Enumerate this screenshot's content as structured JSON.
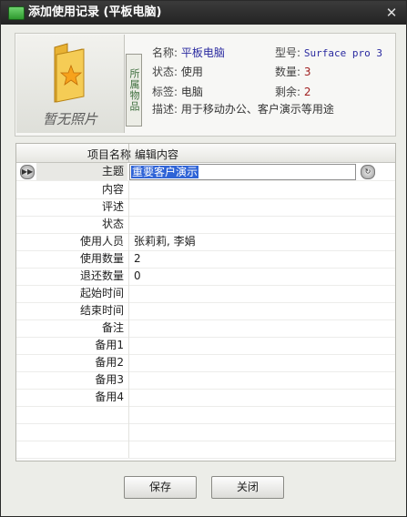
{
  "window": {
    "title": "添加使用记录 (平板电脑)",
    "close_glyph": "✕"
  },
  "item": {
    "photo_caption": "暂无照片",
    "category_tag": "所属物品",
    "name_label": "名称:",
    "name": "平板电脑",
    "model_label": "型号:",
    "model": "Surface pro 3",
    "status_label": "状态:",
    "status": "使用",
    "quantity_label": "数量:",
    "quantity": "3",
    "tag_label": "标签:",
    "tag": "电脑",
    "remaining_label": "剩余:",
    "remaining": "2",
    "desc_label": "描述:",
    "desc": "用于移动办公、客户演示等用途"
  },
  "grid": {
    "col_name": "项目名称",
    "col_value": "编辑内容",
    "rows": [
      {
        "name": "主题",
        "value": "重要客户演示"
      },
      {
        "name": "内容",
        "value": ""
      },
      {
        "name": "评述",
        "value": ""
      },
      {
        "name": "状态",
        "value": ""
      },
      {
        "name": "使用人员",
        "value": "张莉莉, 李娟"
      },
      {
        "name": "使用数量",
        "value": "2"
      },
      {
        "name": "退还数量",
        "value": "0"
      },
      {
        "name": "起始时间",
        "value": ""
      },
      {
        "name": "结束时间",
        "value": ""
      },
      {
        "name": "备注",
        "value": ""
      },
      {
        "name": "备用1",
        "value": ""
      },
      {
        "name": "备用2",
        "value": ""
      },
      {
        "name": "备用3",
        "value": ""
      },
      {
        "name": "备用4",
        "value": ""
      }
    ]
  },
  "buttons": {
    "save": "保存",
    "close": "关闭"
  },
  "icons": {
    "row_indicator": "play-forward-icon",
    "reset": "refresh-icon",
    "folder": "folder-star-icon"
  }
}
